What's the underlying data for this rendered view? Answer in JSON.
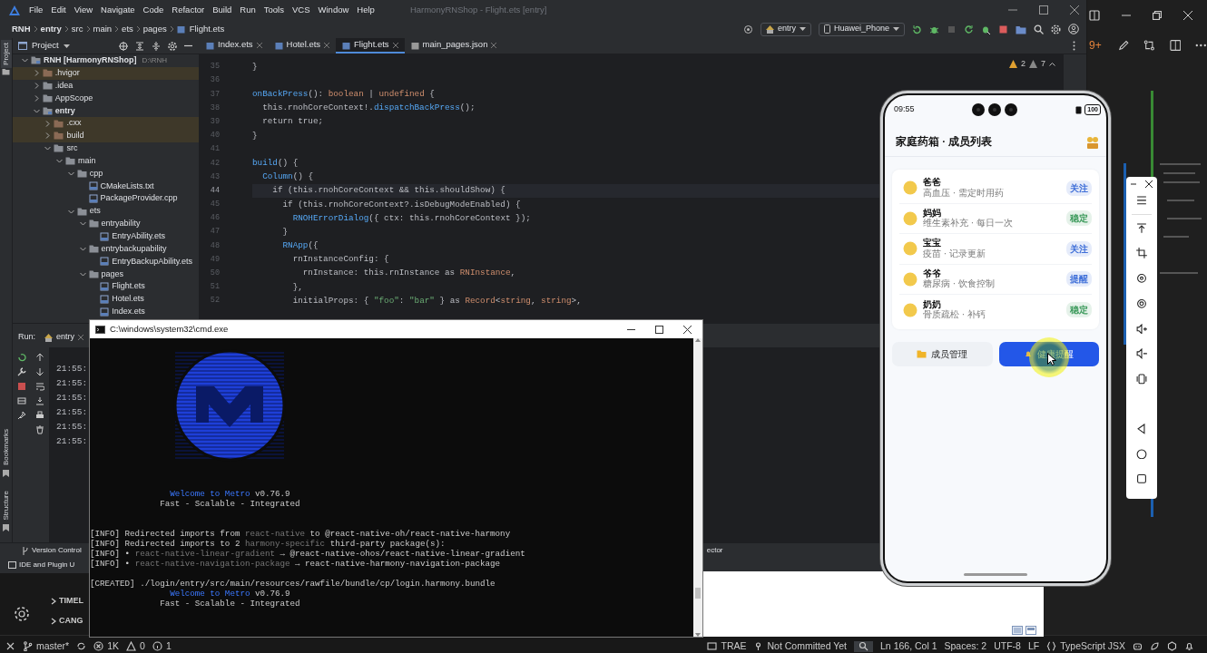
{
  "vscode": {
    "notification_badge": "9+",
    "sidebar_sections": [
      "TIMEL",
      "CANG"
    ],
    "status_bar": {
      "branch": "master*",
      "errors": "1K",
      "warnings": "0",
      "infos": "1",
      "tool": "TRAE",
      "blame": "Not Committed Yet",
      "position": "Ln 166, Col 1",
      "indent": "Spaces: 2",
      "encoding": "UTF-8",
      "eol": "LF",
      "language": "TypeScript JSX"
    }
  },
  "ide": {
    "menu": [
      "File",
      "Edit",
      "View",
      "Navigate",
      "Code",
      "Refactor",
      "Build",
      "Run",
      "Tools",
      "VCS",
      "Window",
      "Help"
    ],
    "title": "HarmonyRNShop - Flight.ets [entry]",
    "breadcrumb": [
      "RNH",
      "entry",
      "src",
      "main",
      "ets",
      "pages",
      "Flight.ets"
    ],
    "run_config": "entry",
    "device": "Huawei_Phone",
    "project_label": "Project",
    "tabs": [
      {
        "label": "Index.ets",
        "selected": false
      },
      {
        "label": "Hotel.ets",
        "selected": false
      },
      {
        "label": "Flight.ets",
        "selected": true
      },
      {
        "label": "main_pages.json",
        "selected": false
      }
    ],
    "tree": [
      {
        "name": "RNH [HarmonyRNShop]",
        "note": "D:\\RNH",
        "kind": "module",
        "expanded": true,
        "excluded": false,
        "children": [
          {
            "name": ".hvigor",
            "kind": "folder",
            "expanded": false,
            "excluded": true
          },
          {
            "name": ".idea",
            "kind": "folder",
            "expanded": false,
            "excluded": false
          },
          {
            "name": "AppScope",
            "kind": "folder",
            "expanded": false,
            "excluded": false
          },
          {
            "name": "entry",
            "kind": "module",
            "expanded": true,
            "excluded": false,
            "children": [
              {
                "name": ".cxx",
                "kind": "folder",
                "expanded": false,
                "excluded": true
              },
              {
                "name": "build",
                "kind": "folder",
                "expanded": false,
                "excluded": true
              },
              {
                "name": "src",
                "kind": "folder",
                "expanded": true,
                "excluded": false,
                "children": [
                  {
                    "name": "main",
                    "kind": "folder",
                    "expanded": true,
                    "excluded": false,
                    "children": [
                      {
                        "name": "cpp",
                        "kind": "folder",
                        "expanded": true,
                        "excluded": false,
                        "children": [
                          {
                            "name": "CMakeLists.txt",
                            "kind": "file"
                          },
                          {
                            "name": "PackageProvider.cpp",
                            "kind": "file"
                          }
                        ]
                      },
                      {
                        "name": "ets",
                        "kind": "folder",
                        "expanded": true,
                        "excluded": false,
                        "children": [
                          {
                            "name": "entryability",
                            "kind": "folder",
                            "expanded": true,
                            "excluded": false,
                            "children": [
                              {
                                "name": "EntryAbility.ets",
                                "kind": "file"
                              }
                            ]
                          },
                          {
                            "name": "entrybackupability",
                            "kind": "folder",
                            "expanded": true,
                            "excluded": false,
                            "children": [
                              {
                                "name": "EntryBackupAbility.ets",
                                "kind": "file"
                              }
                            ]
                          },
                          {
                            "name": "pages",
                            "kind": "folder",
                            "expanded": true,
                            "excluded": false,
                            "children": [
                              {
                                "name": "Flight.ets",
                                "kind": "file"
                              },
                              {
                                "name": "Hotel.ets",
                                "kind": "file"
                              },
                              {
                                "name": "Index.ets",
                                "kind": "file"
                              }
                            ]
                          }
                        ]
                      }
                    ]
                  }
                ]
              }
            ]
          }
        ]
      }
    ],
    "inspections": {
      "warnings": "2",
      "weak_warnings": "7"
    },
    "code_lines": [
      {
        "number": "35",
        "current": false,
        "segments": [
          {
            "text": "}",
            "kind": "plain"
          }
        ]
      },
      {
        "number": "36",
        "current": false
      },
      {
        "number": "37",
        "current": false,
        "segments": [
          {
            "text": "onBackPress",
            "kind": "fn"
          },
          {
            "text": "(): ",
            "kind": "plain"
          },
          {
            "text": "boolean",
            "kind": "type"
          },
          {
            "text": " | ",
            "kind": "plain"
          },
          {
            "text": "undefined",
            "kind": "type"
          },
          {
            "text": " {",
            "kind": "plain"
          }
        ]
      },
      {
        "number": "38",
        "current": false,
        "segments": [
          {
            "text": "  this.rnohCoreContext!.",
            "kind": "plain"
          },
          {
            "text": "dispatchBackPress",
            "kind": "fn"
          },
          {
            "text": "();",
            "kind": "plain"
          }
        ]
      },
      {
        "number": "39",
        "current": false,
        "segments": [
          {
            "text": "  return true;",
            "kind": "plain"
          }
        ]
      },
      {
        "number": "40",
        "current": false,
        "segments": [
          {
            "text": "}",
            "kind": "plain"
          }
        ]
      },
      {
        "number": "41",
        "current": false
      },
      {
        "number": "42",
        "current": false,
        "segments": [
          {
            "text": "build",
            "kind": "fn"
          },
          {
            "text": "() {",
            "kind": "plain"
          }
        ]
      },
      {
        "number": "43",
        "current": false,
        "segments": [
          {
            "text": "  Column",
            "kind": "fn"
          },
          {
            "text": "() {",
            "kind": "plain"
          }
        ]
      },
      {
        "number": "44",
        "current": true,
        "segments": [
          {
            "text": "    if (this.rnohCoreContext && this.shouldShow) {",
            "kind": "plain"
          }
        ]
      },
      {
        "number": "45",
        "current": false,
        "segments": [
          {
            "text": "      if (this.rnohCoreContext?.isDebugModeEnabled) {",
            "kind": "plain"
          }
        ]
      },
      {
        "number": "46",
        "current": false,
        "segments": [
          {
            "text": "        RNOHErrorDialog",
            "kind": "fn"
          },
          {
            "text": "({ ctx: this.rnohCoreContext });",
            "kind": "plain"
          }
        ]
      },
      {
        "number": "47",
        "current": false,
        "segments": [
          {
            "text": "      }",
            "kind": "plain"
          }
        ]
      },
      {
        "number": "48",
        "current": false,
        "segments": [
          {
            "text": "      RNApp",
            "kind": "fn"
          },
          {
            "text": "({",
            "kind": "plain"
          }
        ]
      },
      {
        "number": "49",
        "current": false,
        "segments": [
          {
            "text": "        rnInstanceConfig: {",
            "kind": "plain"
          }
        ]
      },
      {
        "number": "50",
        "current": false,
        "segments": [
          {
            "text": "          rnInstance: this.rnInstance as ",
            "kind": "plain"
          },
          {
            "text": "RNInstance",
            "kind": "type"
          },
          {
            "text": ",",
            "kind": "plain"
          }
        ]
      },
      {
        "number": "51",
        "current": false,
        "segments": [
          {
            "text": "        },",
            "kind": "plain"
          }
        ]
      },
      {
        "number": "52",
        "current": false,
        "segments": [
          {
            "text": "        initialProps: { ",
            "kind": "plain"
          },
          {
            "text": "\"foo\"",
            "kind": "str"
          },
          {
            "text": ": ",
            "kind": "plain"
          },
          {
            "text": "\"bar\"",
            "kind": "str"
          },
          {
            "text": " } as ",
            "kind": "plain"
          },
          {
            "text": "Record",
            "kind": "type"
          },
          {
            "text": "<",
            "kind": "plain"
          },
          {
            "text": "string",
            "kind": "type"
          },
          {
            "text": ", ",
            "kind": "plain"
          },
          {
            "text": "string",
            "kind": "type"
          },
          {
            "text": ">,",
            "kind": "plain"
          }
        ]
      }
    ],
    "side_tabs": [
      {
        "label": "Project",
        "selected": true
      },
      {
        "label": "Bookmarks",
        "selected": false
      },
      {
        "label": "Structure",
        "selected": false
      }
    ],
    "run": {
      "label": "Run:",
      "tab": "entry",
      "log_times": [
        "21:55:",
        "21:55:",
        "21:55:",
        "21:55:",
        "21:55:",
        "21:55:"
      ]
    },
    "bottom_tabs": [
      "Version Control",
      "ector"
    ],
    "status_text": "IDE and Plugin U"
  },
  "cmd": {
    "title": "C:\\windows\\system32\\cmd.exe",
    "blocks": [
      [
        [
          {
            "text": "                Welcome to Metro",
            "kind": "blue"
          },
          {
            "text": " v0.76.9",
            "kind": "plain"
          }
        ],
        [
          {
            "text": "              Fast - Scalable - Integrated",
            "kind": "plain"
          }
        ]
      ],
      [
        [
          {
            "text": "[INFO] Redirected imports from ",
            "kind": "plain"
          },
          {
            "text": "react-native",
            "kind": "dim"
          },
          {
            "text": " to @react-native-oh/react-native-harmony",
            "kind": "plain"
          }
        ],
        [
          {
            "text": "[INFO] Redirected imports to 2 ",
            "kind": "plain"
          },
          {
            "text": "harmony-specific",
            "kind": "dim"
          },
          {
            "text": " third-party package(s):",
            "kind": "plain"
          }
        ],
        [
          {
            "text": "[INFO] • ",
            "kind": "plain"
          },
          {
            "text": "react-native-linear-gradient",
            "kind": "dim"
          },
          {
            "text": " → @react-native-ohos/react-native-linear-gradient",
            "kind": "plain"
          }
        ],
        [
          {
            "text": "[INFO] • ",
            "kind": "plain"
          },
          {
            "text": "react-native-navigation-package",
            "kind": "dim"
          },
          {
            "text": " → react-native-harmony-navigation-package",
            "kind": "plain"
          }
        ]
      ],
      [
        [
          {
            "text": "[CREATED] ./login/entry/src/main/resources/rawfile/bundle/cp/login.harmony.bundle",
            "kind": "plain"
          }
        ],
        [
          {
            "text": "                Welcome to Metro",
            "kind": "blue"
          },
          {
            "text": " v0.76.9",
            "kind": "plain"
          }
        ],
        [
          {
            "text": "              Fast - Scalable - Integrated",
            "kind": "plain"
          }
        ]
      ]
    ]
  },
  "phone": {
    "time": "09:55",
    "battery": "100",
    "title": "家庭药箱 · 成员列表",
    "members": [
      {
        "name": "爸爸",
        "note": "高血压 · 需定时用药",
        "tag": "关注",
        "color": "#3f6fd8"
      },
      {
        "name": "妈妈",
        "note": "维生素补充 · 每日一次",
        "tag": "稳定",
        "color": "#3d9a5c"
      },
      {
        "name": "宝宝",
        "note": "疫苗 · 记录更新",
        "tag": "关注",
        "color": "#3f6fd8"
      },
      {
        "name": "爷爷",
        "note": "糖尿病 · 饮食控制",
        "tag": "提醒",
        "color": "#3f6fd8"
      },
      {
        "name": "奶奶",
        "note": "骨质疏松 · 补钙",
        "tag": "稳定",
        "color": "#3d9a5c"
      }
    ],
    "buttons": [
      {
        "label": "成员管理",
        "kind": "secondary"
      },
      {
        "label": "健康提醒",
        "kind": "primary"
      }
    ]
  }
}
